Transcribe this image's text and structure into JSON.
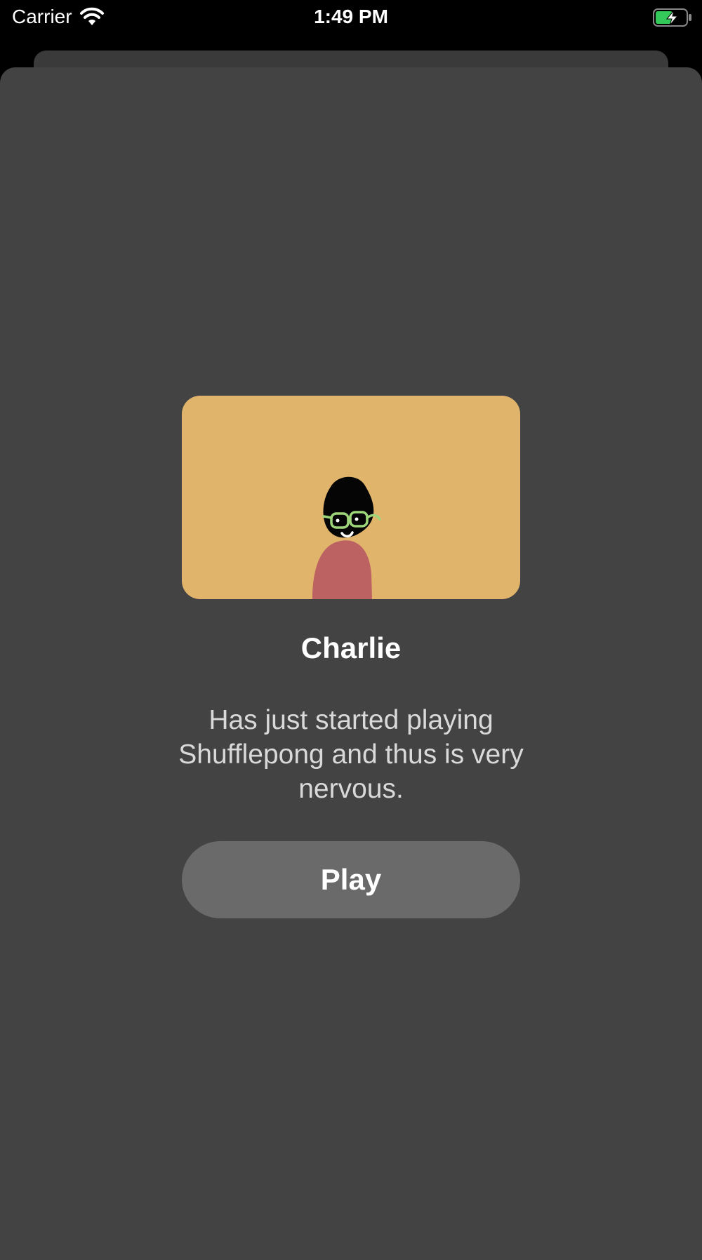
{
  "status_bar": {
    "carrier": "Carrier",
    "time": "1:49 PM",
    "battery_color": "#34c759"
  },
  "card": {
    "illustration_bg": "#e0b46a",
    "name": "Charlie",
    "description": "Has just started playing Shufflepong and thus is very nervous.",
    "play_label": "Play"
  }
}
